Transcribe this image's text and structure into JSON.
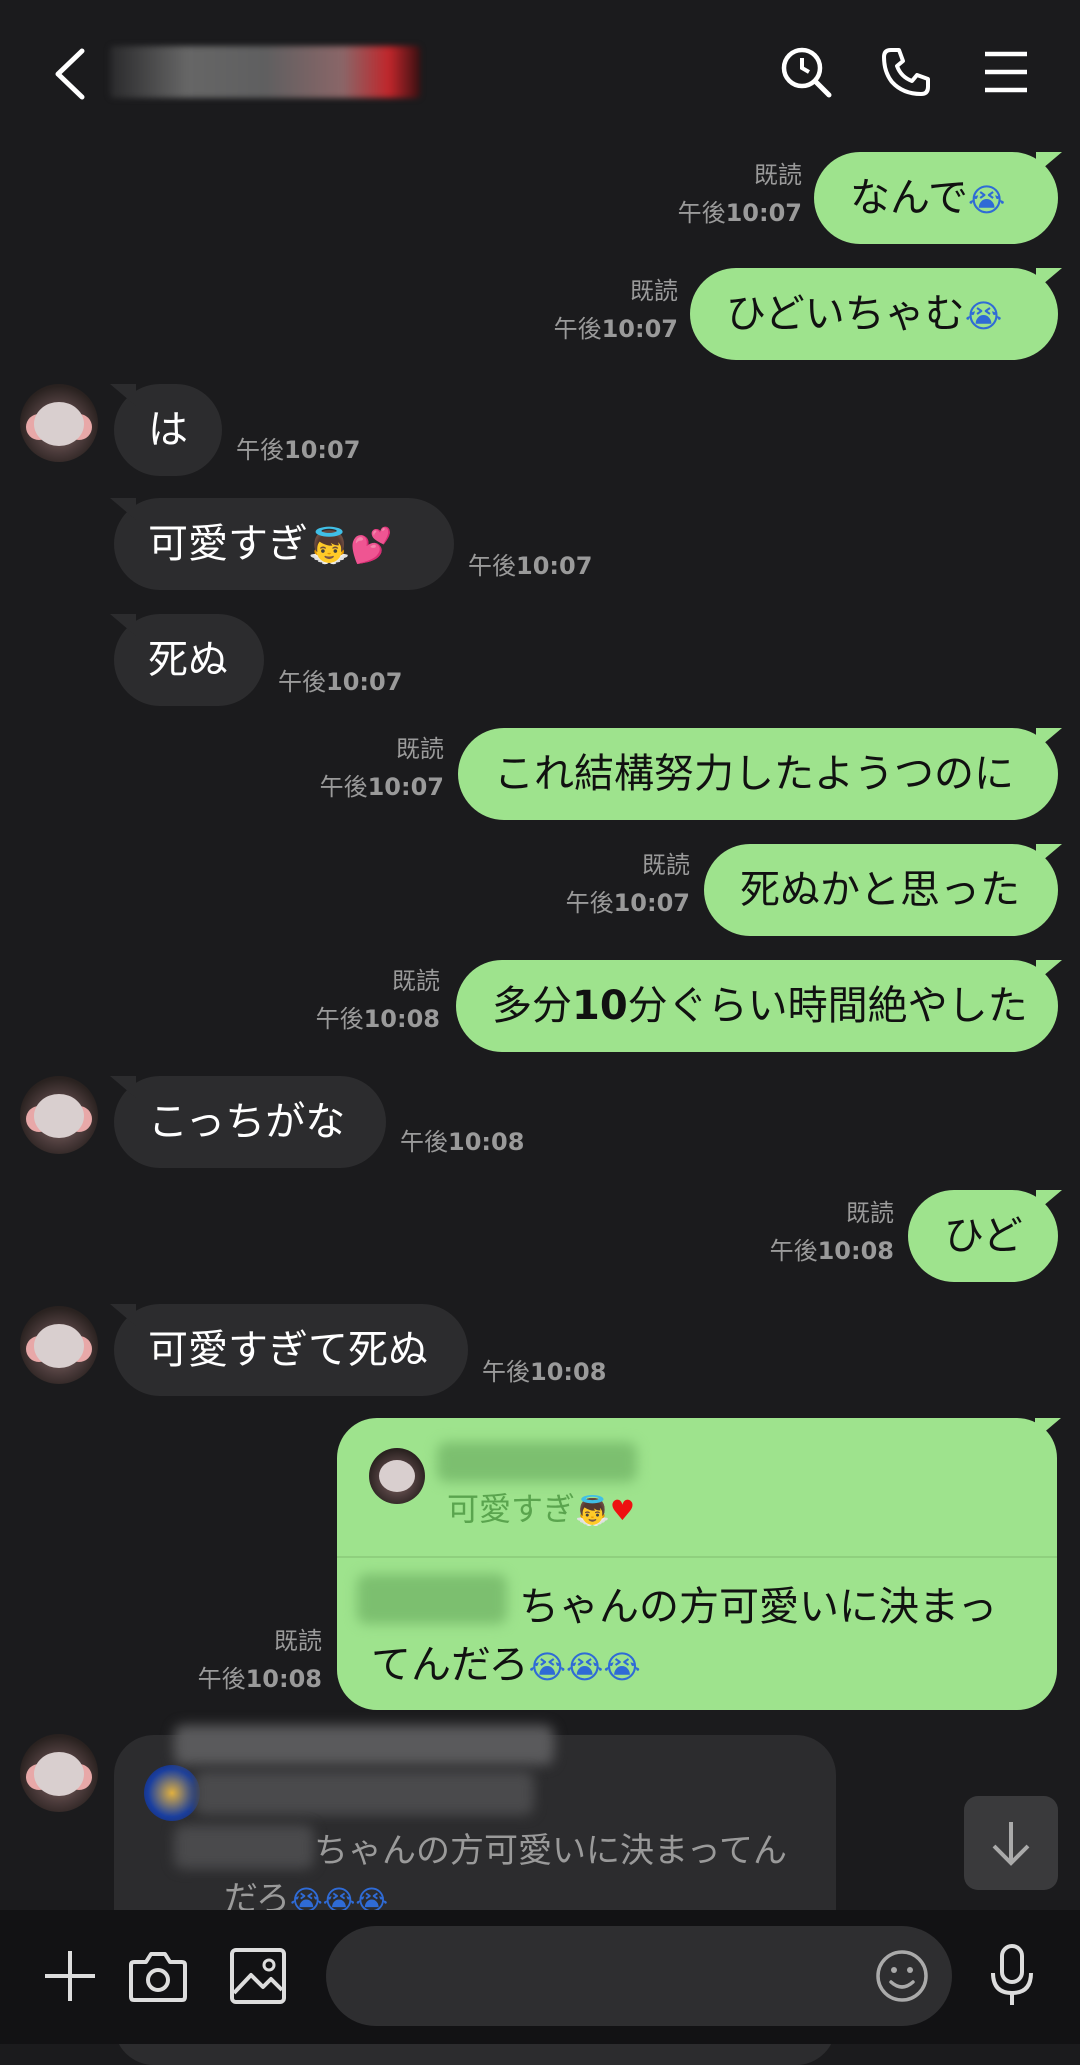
{
  "header": {
    "back_icon": "chevron-left-icon",
    "search_icon": "search-icon",
    "call_icon": "phone-icon",
    "menu_icon": "menu-icon"
  },
  "messages": [
    {
      "dir": "out",
      "text": "なんで",
      "emoji": "😭",
      "read": "既読",
      "time_prefix": "午後",
      "time": "10:07"
    },
    {
      "dir": "out",
      "text": "ひどいちゃむ",
      "emoji": "😭",
      "read": "既読",
      "time_prefix": "午後",
      "time": "10:07"
    },
    {
      "dir": "in",
      "text": "は",
      "time_prefix": "午後",
      "time": "10:07"
    },
    {
      "dir": "in",
      "text": "可愛すぎ",
      "emoji_angel": "👼",
      "emoji_heart": "💕",
      "time_prefix": "午後",
      "time": "10:07"
    },
    {
      "dir": "in",
      "text": "死ぬ",
      "time_prefix": "午後",
      "time": "10:07"
    },
    {
      "dir": "out",
      "text": "これ結構努力したようつのに",
      "read": "既読",
      "time_prefix": "午後",
      "time": "10:07"
    },
    {
      "dir": "out",
      "text": "死ぬかと思った",
      "read": "既読",
      "time_prefix": "午後",
      "time": "10:07"
    },
    {
      "dir": "out",
      "text_a": "多分",
      "text_b": "10",
      "text_c": "分ぐらい時間絶やした",
      "read": "既読",
      "time_prefix": "午後",
      "time": "10:08"
    },
    {
      "dir": "in",
      "text": "こっちがな",
      "time_prefix": "午後",
      "time": "10:08"
    },
    {
      "dir": "out",
      "text": "ひど",
      "read": "既読",
      "time_prefix": "午後",
      "time": "10:08"
    },
    {
      "dir": "in",
      "text": "可愛すぎて死ぬ",
      "time_prefix": "午後",
      "time": "10:08"
    },
    {
      "dir": "out",
      "quote": "可愛すぎ",
      "quote_angel": "👼",
      "quote_heart": "♥",
      "line1": "ちゃんの方可愛いに決まっ",
      "line2": "てんだろ",
      "cry": "😭😭😭",
      "read": "既読",
      "time_prefix": "午後",
      "time": "10:08"
    },
    {
      "dir": "in",
      "line1": "ちゃんの方可愛いに決まってん",
      "line2": "だろ",
      "cry": "😭😭😭"
    }
  ],
  "bottom": {
    "plus_icon": "plus-icon",
    "camera_icon": "camera-icon",
    "image_icon": "image-icon",
    "emoji_icon": "smile-icon",
    "mic_icon": "mic-icon",
    "scroll_icon": "arrow-down-icon"
  },
  "colors": {
    "bg": "#1b1b1d",
    "bubble_out": "#9ee38d",
    "bubble_in": "#2c2c2e",
    "meta": "#9a9a9a"
  }
}
